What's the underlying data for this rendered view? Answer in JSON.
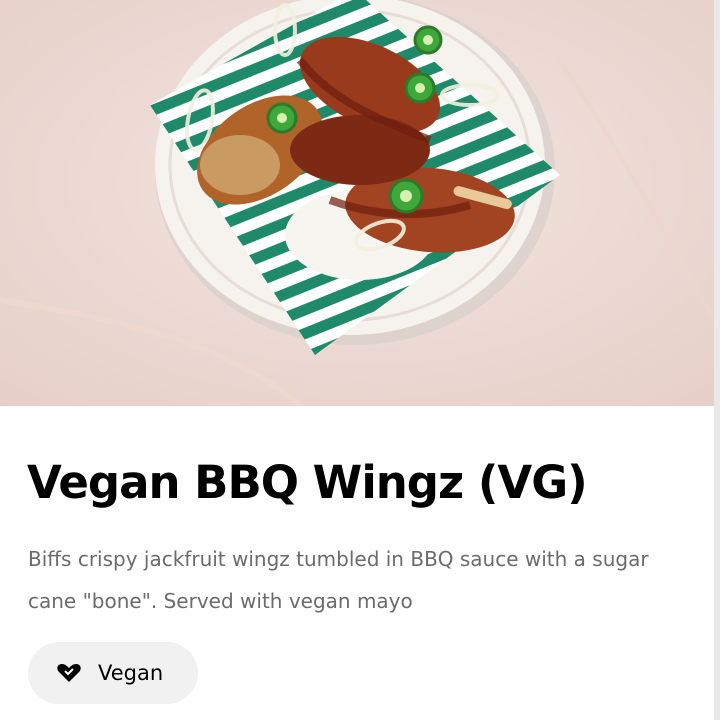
{
  "item": {
    "title": "Vegan BBQ Wingz (VG)",
    "description": "Biffs crispy jackfruit wingz tumbled in BBQ sauce with a sugar cane \"bone\". Served with vegan mayo",
    "image_icon": "food-photo",
    "tag": {
      "icon": "heart-icon",
      "label": "Vegan"
    }
  },
  "colors": {
    "tag_background": "#f1f1f1",
    "description_text": "#6b6b6b",
    "paper_green": "#1f8a6a"
  }
}
